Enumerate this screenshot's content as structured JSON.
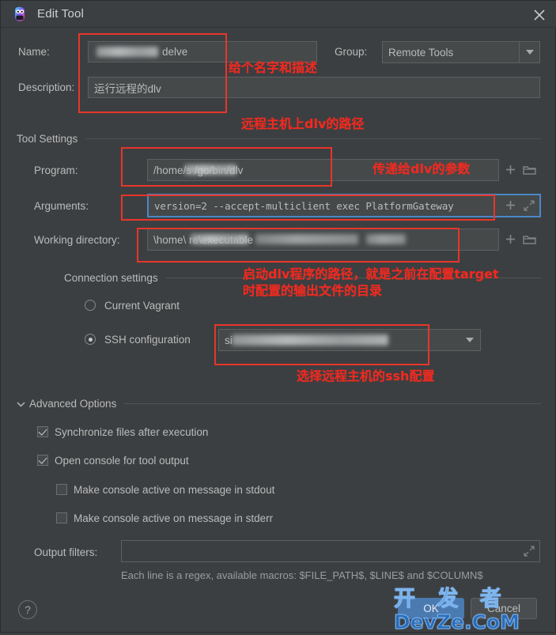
{
  "window": {
    "title": "Edit Tool",
    "app_icon": "goland-logo-icon",
    "close_label": "✕"
  },
  "form": {
    "name_label": "Name:",
    "name_value": "delve",
    "group_label": "Group:",
    "group_value": "Remote Tools",
    "description_label": "Description:",
    "description_value": "运行远程的dlv"
  },
  "tool_settings": {
    "section_title": "Tool Settings",
    "program_label": "Program:",
    "program_value": "/home/s            /go/bin/dlv",
    "arguments_label": "Arguments:",
    "arguments_value": "version=2 --accept-multiclient exec PlatformGateway",
    "working_dir_label": "Working directory:",
    "working_dir_value": "\\home\\                                        re\\executable",
    "insert_macro_icon": "plus-icon",
    "browse_icon": "folder-icon",
    "expand_icon": "expand-icon"
  },
  "connection": {
    "section_title": "Connection settings",
    "option_vagrant": "Current Vagrant",
    "option_ssh": "SSH configuration",
    "selected": "ssh",
    "ssh_value": "si"
  },
  "advanced": {
    "section_title": "Advanced Options",
    "expander_icon": "chevron-down-icon",
    "options": [
      {
        "label": "Synchronize files after execution",
        "checked": true,
        "indent": 0
      },
      {
        "label": "Open console for tool output",
        "checked": true,
        "indent": 0
      },
      {
        "label": "Make console active on message in stdout",
        "checked": false,
        "indent": 1
      },
      {
        "label": "Make console active on message in stderr",
        "checked": false,
        "indent": 1
      }
    ],
    "output_filters_label": "Output filters:",
    "output_filters_value": "",
    "output_filters_hint": "Each line is a regex, available macros: $FILE_PATH$, $LINE$ and $COLUMN$"
  },
  "footer": {
    "help_label": "?",
    "ok_label": "OK",
    "cancel_label": "Cancel"
  },
  "annotations": [
    {
      "id": "name-desc",
      "text": "给个名字和描述"
    },
    {
      "id": "program",
      "text": "远程主机上dlv的路径"
    },
    {
      "id": "arguments",
      "text": "传递给dlv的参数"
    },
    {
      "id": "workdir-1",
      "text": "启动dlv程序的路径，就是之前在配置target"
    },
    {
      "id": "workdir-2",
      "text": "时配置的输出文件的目录"
    },
    {
      "id": "ssh",
      "text": "选择远程主机的ssh配置"
    }
  ],
  "watermark": {
    "line1": "开 发 者",
    "line2": "DevZe.CoM"
  },
  "colors": {
    "dialog_bg": "#3c3f41",
    "field_bg": "#45494a",
    "text": "#bbbbbb",
    "accent_focus": "#4a88c7",
    "primary_button": "#4a7ab0",
    "annotation_red": "#f02a20",
    "watermark_blue": "#2b6cb8"
  }
}
